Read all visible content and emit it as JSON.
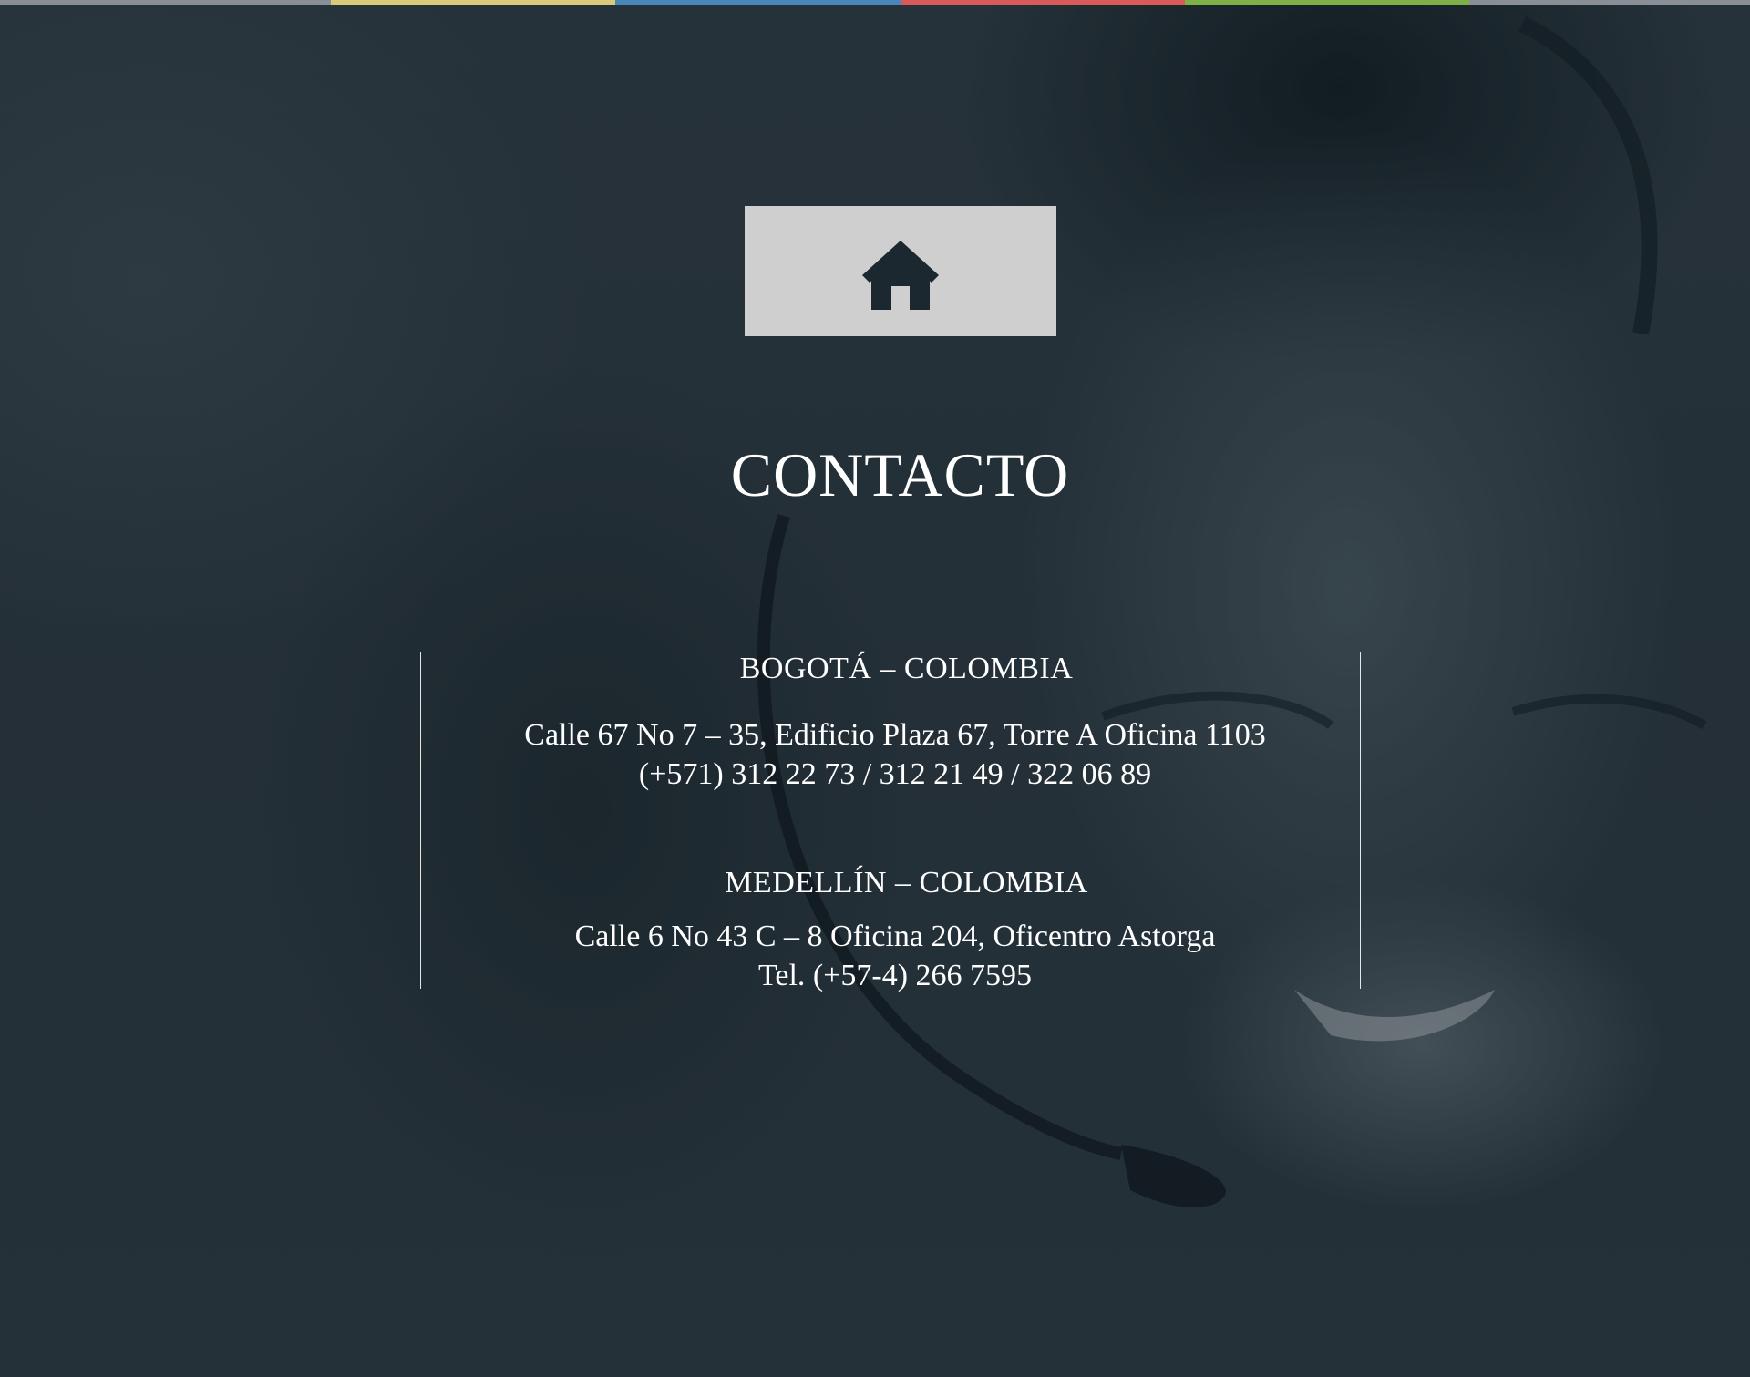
{
  "top_stripe": {
    "colors": [
      "#8a8f95",
      "#d9c97a",
      "#4a86b8",
      "#d85a5a",
      "#7fb045",
      "#8a8f95"
    ]
  },
  "hero": {
    "background_description_color": "#2b3740"
  },
  "home_button": {
    "icon": "home-icon",
    "background": "#cfcfd0",
    "icon_color": "#1c2830"
  },
  "page": {
    "title": "CONTACTO"
  },
  "offices": [
    {
      "heading": "BOGOTÁ – COLOMBIA",
      "address": "Calle 67 No 7 – 35, Edificio Plaza 67, Torre A Oficina 1103",
      "phone": "(+571) 312 22 73 / 312 21 49 / 322 06 89"
    },
    {
      "heading": "MEDELLÍN – COLOMBIA",
      "address": "Calle 6 No 43 C – 8 Oficina 204, Oficentro Astorga",
      "phone": "Tel. (+57-4) 266 7595"
    }
  ]
}
